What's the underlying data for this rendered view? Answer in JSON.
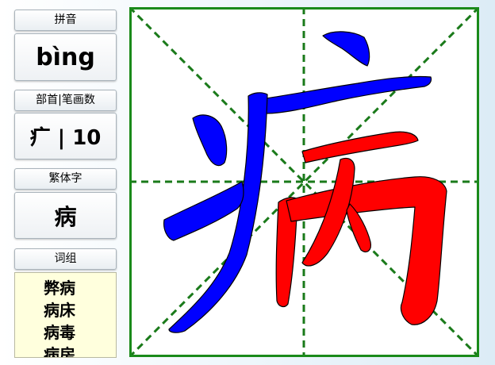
{
  "sidebar": {
    "pinyin": {
      "header": "拼音",
      "value": "bìng"
    },
    "radical_strokes": {
      "header": "部首|笔画数",
      "value": "疒 | 10"
    },
    "traditional": {
      "header": "繁体字",
      "value": "病"
    },
    "words": {
      "header": "词组",
      "items": [
        "弊病",
        "病床",
        "病毒",
        "病房"
      ]
    }
  },
  "grid": {
    "character": "病",
    "border_color": "#1a8a1a",
    "guide_color": "#1a7a1a",
    "radical_color": "#0000ff",
    "component_color": "#ff0000"
  }
}
